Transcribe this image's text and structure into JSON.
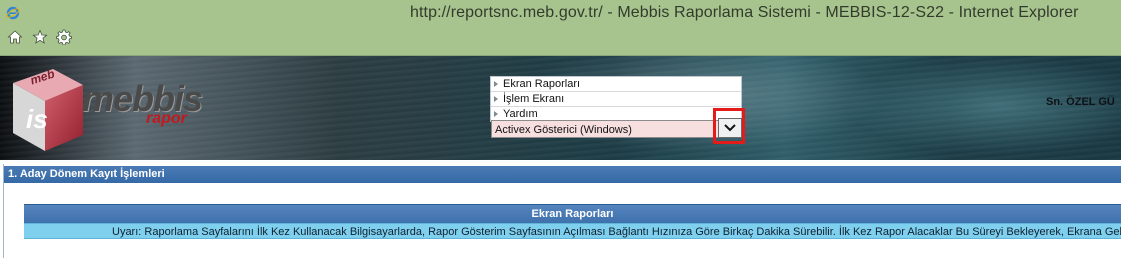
{
  "window": {
    "title": "http://reportsnc.meb.gov.tr/ - Mebbis Raporlama Sistemi - MEBBIS-12-S22 - Internet Explorer"
  },
  "toolbar_icons": [
    "home-icon",
    "star-icon",
    "gear-icon"
  ],
  "banner": {
    "logo_text": "mebbis",
    "logo_subtext": "rapor",
    "logo_cube_text_top": "meb",
    "logo_cube_text_bottom": "is",
    "menu_items": [
      {
        "label": "Ekran Raporları"
      },
      {
        "label": "İşlem Ekranı"
      },
      {
        "label": "Yardım"
      }
    ],
    "viewer_select": {
      "selected": "Activex Gösterici (Windows)"
    },
    "user_label": "Sn. ÖZEL GÜ"
  },
  "section": {
    "title": "1. Aday Dönem Kayıt İşlemleri"
  },
  "panel": {
    "title": "Ekran Raporları",
    "warning": "Uyarı: Raporlama Sayfalarını İlk Kez Kullanacak Bilgisayarlarda, Rapor Gösterim Sayfasının Açılması Bağlantı Hızınıza Göre Birkaç Dakika Sürebilir. İlk Kez Rapor Alacaklar Bu Süreyi Bekleyerek, Ekrana Gelecek Güv"
  },
  "colors": {
    "titlebar": "#a7c48f",
    "section_bar": "#356aa6",
    "warning_row": "#7fd0ee",
    "select_bg": "#f7dfe0",
    "highlight": "#e41b1b"
  }
}
